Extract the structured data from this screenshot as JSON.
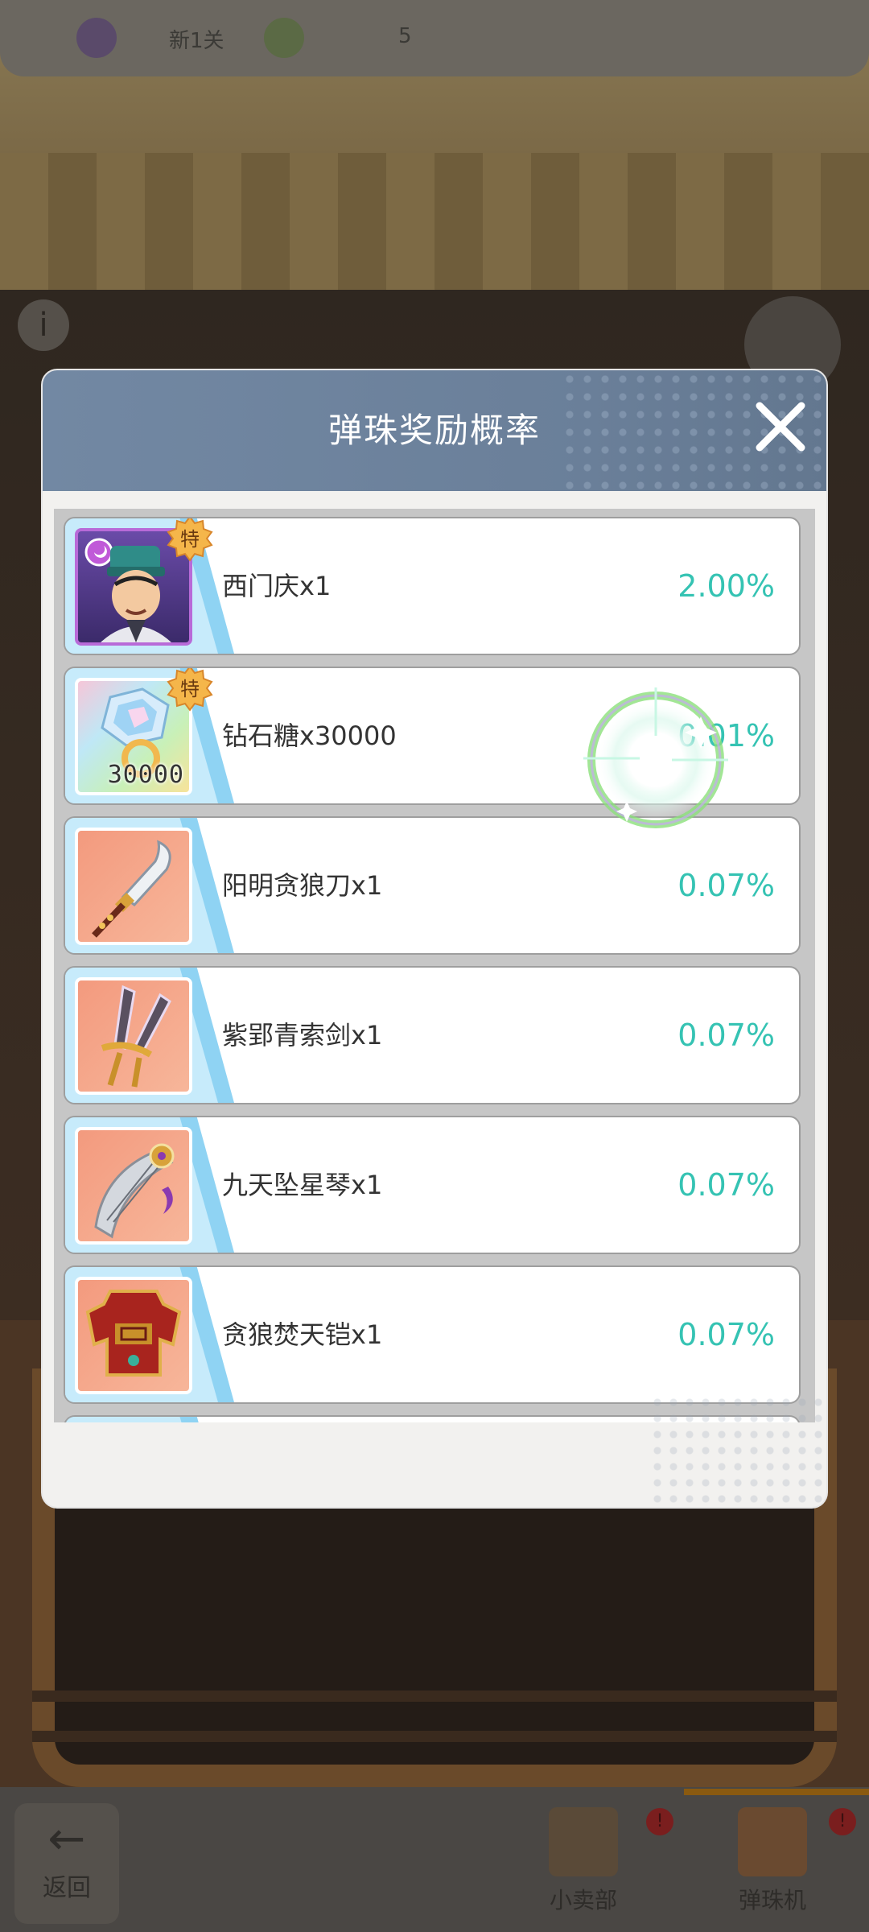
{
  "background": {
    "top_bar": {
      "left_text": "新1关",
      "right_text": "5"
    },
    "bottom_nav": {
      "back": {
        "icon": "back-arrow-icon",
        "label": "返回"
      },
      "items": [
        {
          "label": "小卖部",
          "badge": "!"
        },
        {
          "label": "弹珠机",
          "badge": "!"
        }
      ]
    }
  },
  "modal": {
    "title": "弹珠奖励概率",
    "close_icon": "close-x-icon",
    "accent_color": "#35c3b3",
    "header_color": "#6f84a0",
    "items": [
      {
        "name": "西门庆x1",
        "probability": "2.00%",
        "icon": "hero-ximenqing-icon",
        "special": "特"
      },
      {
        "name": "钻石糖x30000",
        "probability": "0.01%",
        "icon": "diamond-candy-icon",
        "special": "特",
        "quantity": "30000"
      },
      {
        "name": "阳明贪狼刀x1",
        "probability": "0.07%",
        "icon": "blade-icon"
      },
      {
        "name": "紫郢青索剑x1",
        "probability": "0.07%",
        "icon": "twin-swords-icon"
      },
      {
        "name": "九天坠星琴x1",
        "probability": "0.07%",
        "icon": "zither-icon"
      },
      {
        "name": "贪狼焚天铠x1",
        "probability": "0.07%",
        "icon": "armor-icon"
      }
    ]
  }
}
